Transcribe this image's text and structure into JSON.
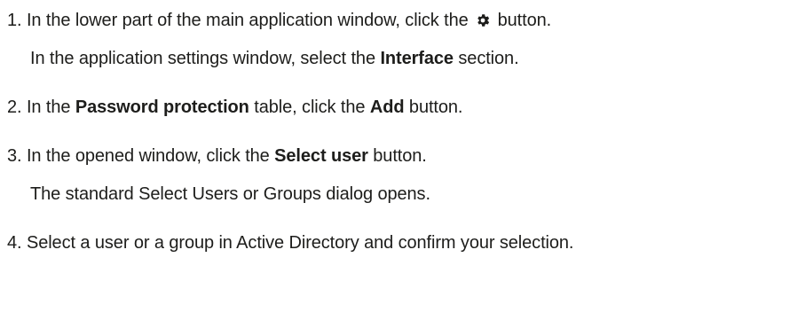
{
  "steps": [
    {
      "number": "1.",
      "line1": {
        "before": "In the lower part of the main application window, click the",
        "after": "button."
      },
      "line2": {
        "before": "In the application settings window, select the",
        "bold": "Interface",
        "after": "section."
      },
      "icon": "gear-icon"
    },
    {
      "number": "2.",
      "line1": {
        "before": "In the",
        "bold1": "Password protection",
        "middle": "table, click the",
        "bold2": "Add",
        "after": "button."
      }
    },
    {
      "number": "3.",
      "line1": {
        "before": "In the opened window, click the",
        "bold": "Select user",
        "after": "button."
      },
      "line2": {
        "text": "The standard Select Users or Groups dialog opens."
      }
    },
    {
      "number": "4.",
      "line1": {
        "text": "Select a user or a group in Active Directory and confirm your selection."
      }
    }
  ]
}
